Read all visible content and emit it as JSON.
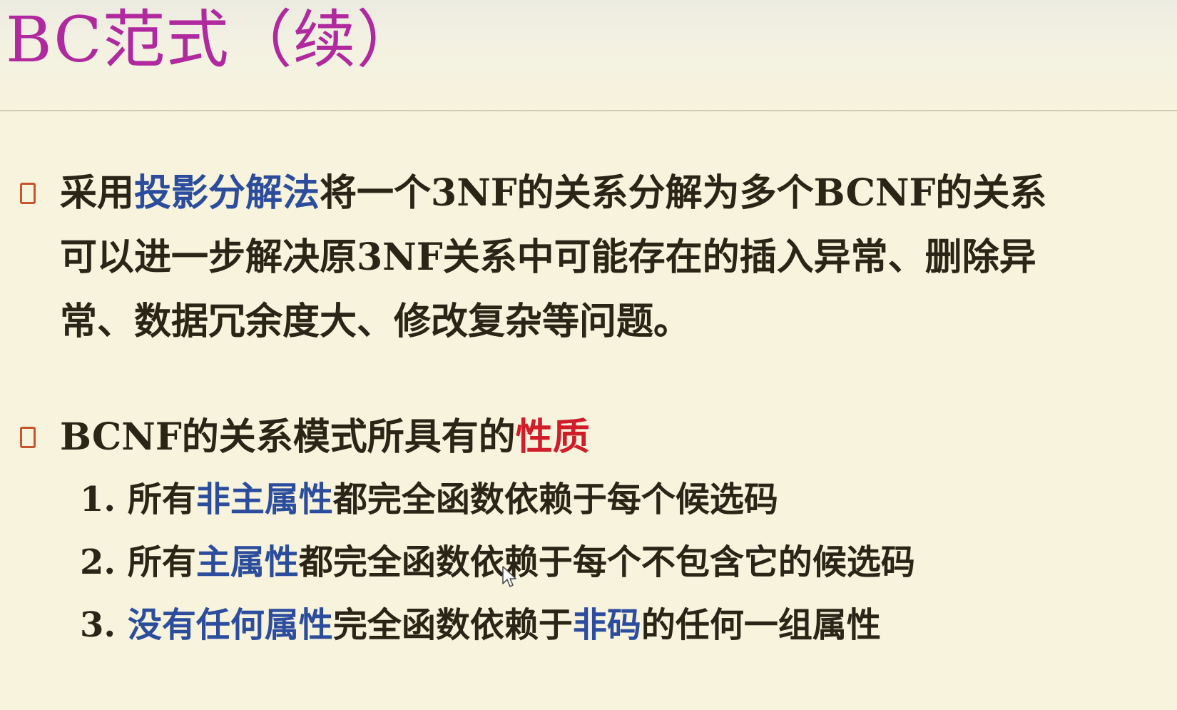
{
  "title": "BC范式（续）",
  "bullet1": {
    "part1": "采用",
    "highlight": "投影分解法",
    "part2": "将一个3NF的关系分解为多个BCNF的关系",
    "line2": "可以进一步解决原3NF关系中可能存在的插入异常、删除异",
    "line3": "常、数据冗余度大、修改复杂等问题。"
  },
  "bullet2": {
    "part1": "BCNF的关系模式所具有的",
    "highlight": "性质"
  },
  "properties": [
    {
      "num": "1. ",
      "pre": "所有",
      "hl1": "非主属性",
      "mid": "都完全函数依赖于每个候选码",
      "hl2": "",
      "post": ""
    },
    {
      "num": "2. ",
      "pre": "所有",
      "hl1": "主属性",
      "mid": "都完全函数依赖于每个不包含它的候选码",
      "hl2": "",
      "post": ""
    },
    {
      "num": "3. ",
      "pre": "",
      "hl1": "没有任何属性",
      "mid": "完全函数依赖于",
      "hl2": "非码",
      "post": "的任何一组属性"
    }
  ]
}
